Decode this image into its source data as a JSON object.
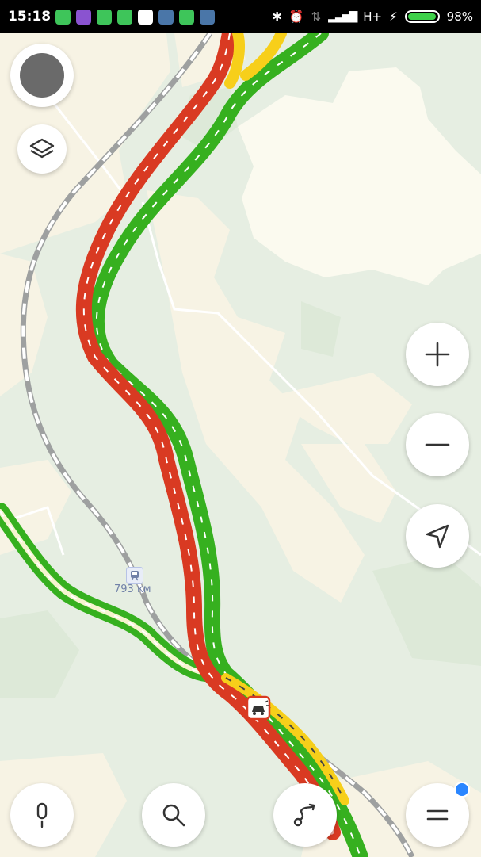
{
  "status_bar": {
    "time": "15:18",
    "network": "H+",
    "battery_percent": "98%",
    "battery_level": 0.98,
    "app_icons": [
      {
        "name": "messaging-app-icon",
        "color": "#3ec55a"
      },
      {
        "name": "viber-icon",
        "color": "#8a53d0"
      },
      {
        "name": "download-icon",
        "color": "#3ec55a"
      },
      {
        "name": "android-app-icon",
        "color": "#3ec55a"
      },
      {
        "name": "mail-icon",
        "color": "#ffffff"
      },
      {
        "name": "vk-icon",
        "color": "#4a76a8"
      },
      {
        "name": "phone-icon",
        "color": "#3ec55a"
      },
      {
        "name": "vk-icon",
        "color": "#4a76a8"
      }
    ]
  },
  "map": {
    "station_label": "793 км",
    "colors": {
      "land": "#e6eee2",
      "cleared": "#f7f3e4",
      "open_field": "#fbfaef",
      "traffic_free": "#36b01f",
      "traffic_jam": "#d93a22",
      "traffic_slow": "#f7cf1a",
      "railway": "#a8a8a8",
      "minor_road": "#ffffff"
    }
  },
  "controls": {
    "layers": "layers-icon",
    "zoom_in": "plus-icon",
    "zoom_out": "minus-icon",
    "locate": "navigation-arrow-icon",
    "voice": "microphone-icon",
    "search": "search-icon",
    "route": "route-icon",
    "menu": "menu-icon"
  }
}
